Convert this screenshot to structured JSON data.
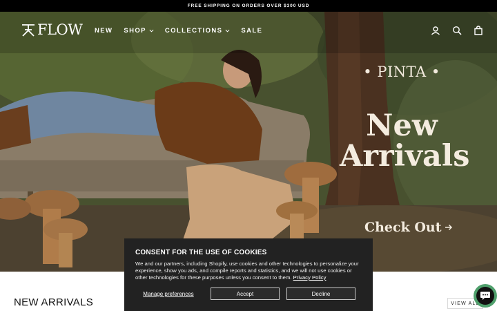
{
  "announcement": {
    "text": "FREE SHIPPING ON ORDERS OVER $300 USD"
  },
  "header": {
    "logo_text": "FLOW",
    "nav": [
      {
        "label": "NEW",
        "has_dropdown": false
      },
      {
        "label": "SHOP",
        "has_dropdown": true
      },
      {
        "label": "COLLECTIONS",
        "has_dropdown": true
      },
      {
        "label": "SALE",
        "has_dropdown": false
      }
    ],
    "icons": [
      "account-icon",
      "search-icon",
      "cart-icon"
    ]
  },
  "hero": {
    "brand_line": "• PINTA •",
    "headline_1": "New",
    "headline_2": "Arrivals",
    "cta_label": "Check Out"
  },
  "new_arrivals": {
    "title": "NEW ARRIVALS",
    "view_all": "VIEW ALL"
  },
  "cookie_banner": {
    "title": "CONSENT FOR THE USE OF COOKIES",
    "body": "We and our partners, including Shopify, use cookies and other technologies to personalize your experience, show you ads, and compile reports and statistics, and we will not use cookies or other technologies for these purposes unless you consent to them.",
    "privacy_link": "Privacy Policy",
    "manage_label": "Manage preferences",
    "accept_label": "Accept",
    "decline_label": "Decline"
  },
  "colors": {
    "announcement_bg": "#000000",
    "cookie_bg": "#222222",
    "chat_accent": "#4fa06c",
    "hero_text": "#f4ecdf"
  }
}
